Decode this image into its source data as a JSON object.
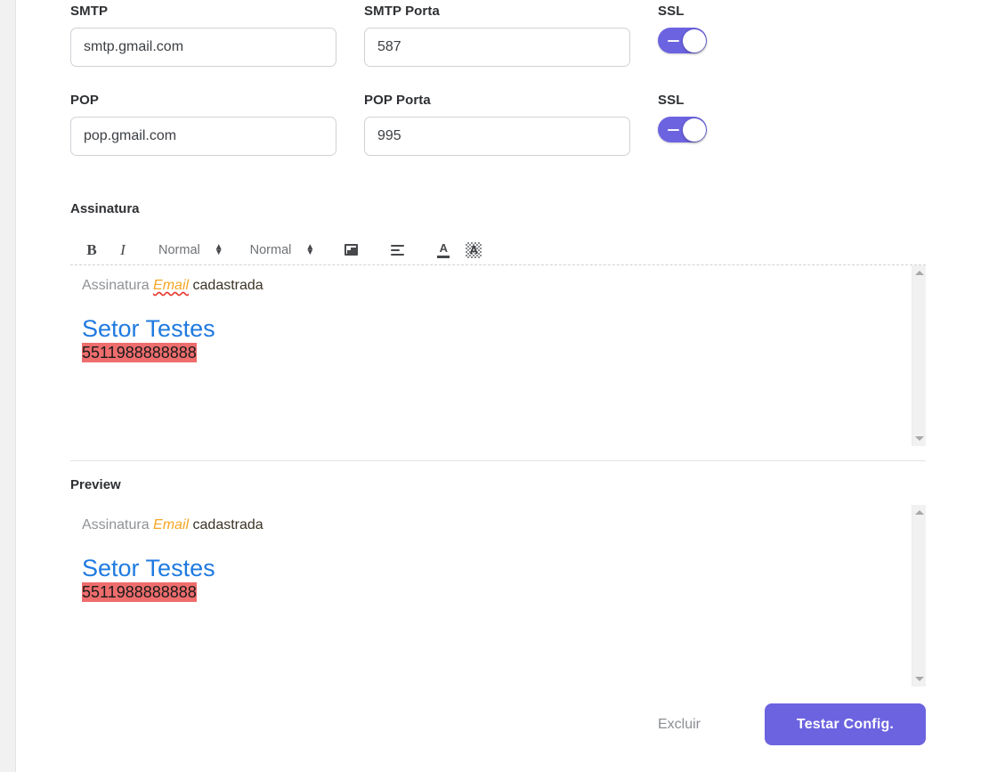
{
  "colors": {
    "accent": "#6c63e0",
    "link_blue": "#1f7ae0",
    "highlight_red": "#ef6d6d",
    "email_orange": "#f5a623",
    "gray_text": "#8f9296",
    "spellcheck_underline": "#e8352a"
  },
  "server_form": {
    "rows": [
      {
        "host_label": "SMTP",
        "host_value": "smtp.gmail.com",
        "port_label": "SMTP Porta",
        "port_value": "587",
        "ssl_label": "SSL",
        "ssl_on": true
      },
      {
        "host_label": "POP",
        "host_value": "pop.gmail.com",
        "port_label": "POP Porta",
        "port_value": "995",
        "ssl_label": "SSL",
        "ssl_on": true
      }
    ]
  },
  "signature": {
    "section_label": "Assinatura",
    "toolbar": {
      "bold_label": "B",
      "italic_label": "I",
      "size_select_value": "Normal",
      "font_select_value": "Normal",
      "image_icon": "image-icon",
      "align_icon": "align-icon",
      "text_color_icon": "text-color-icon",
      "background_color_icon": "background-color-icon"
    },
    "content": {
      "line1_part1": "Assinatura",
      "line1_part2": "Email",
      "line1_part3": "cadastrada",
      "title": "Setor Testes",
      "phone": "5511988888888"
    }
  },
  "preview": {
    "section_label": "Preview",
    "content": {
      "line1_part1": "Assinatura",
      "line1_part2": "Email",
      "line1_part3": "cadastrada",
      "title": "Setor Testes",
      "phone": "5511988888888"
    }
  },
  "footer": {
    "delete_label": "Excluir",
    "test_label": "Testar Config."
  }
}
